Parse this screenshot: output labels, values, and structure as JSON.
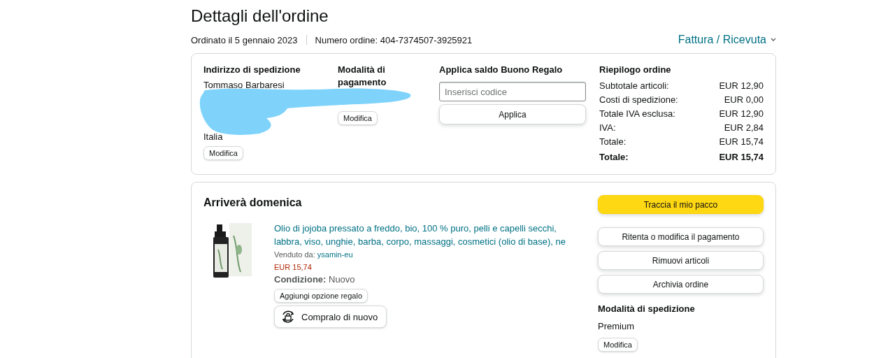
{
  "title": "Dettagli dell'ordine",
  "order_date": "Ordinato il 5 gennaio 2023",
  "order_number": "Numero ordine: 404-7374507-3925921",
  "invoice_link": "Fattura / Ricevuta",
  "shipping_address": {
    "heading": "Indirizzo di spedizione",
    "name": "Tommaso Barbaresi",
    "country": "Italia",
    "button": "Modifica"
  },
  "payment": {
    "heading": "Modalità di pagamento",
    "button": "Modifica"
  },
  "gift_card": {
    "heading": "Applica saldo Buono Regalo",
    "placeholder": "Inserisci codice",
    "button": "Applica"
  },
  "summary": {
    "heading": "Riepilogo ordine",
    "rows": [
      {
        "label": "Subtotale articoli:",
        "value": "EUR 12,90",
        "kind": "normal"
      },
      {
        "label": "Costi di spedizione:",
        "value": "EUR 0,00",
        "kind": "normal"
      },
      {
        "label": "Totale IVA esclusa:",
        "value": "EUR 12,90",
        "kind": "normal"
      },
      {
        "label": "IVA:",
        "value": "EUR 2,84",
        "kind": "normal"
      },
      {
        "label": "Totale:",
        "value": "EUR 15,74",
        "kind": "normal"
      },
      {
        "label": "Totale:",
        "value": "EUR 15,74",
        "kind": "total"
      }
    ]
  },
  "shipment": {
    "heading": "Arriverà domenica",
    "item": {
      "title": "Olio di jojoba pressato a freddo, bio, 100 % puro, pelli e capelli secchi, labbra, viso, unghie, barba, corpo, massaggi, cosmetici (olio di base), ne",
      "sold_by_label": "Venduto da:",
      "seller": "ysamin-eu",
      "price": "EUR 15,74",
      "condition": "**Condizione:** Nuovo",
      "gift_button": "Aggiungi opzione regalo",
      "buy_again_button": "Compralo di nuovo"
    },
    "actions": [
      {
        "label": "Traccia il mio pacco",
        "kind": "primary"
      },
      {
        "label": "Ritenta o modifica il pagamento",
        "kind": "secondary"
      },
      {
        "label": "Rimuovi articoli",
        "kind": "secondary"
      },
      {
        "label": "Archivia ordine",
        "kind": "secondary"
      }
    ],
    "shipping_method": {
      "heading": "Modalità di spedizione",
      "value": "Premium",
      "button": "Modifica"
    }
  }
}
